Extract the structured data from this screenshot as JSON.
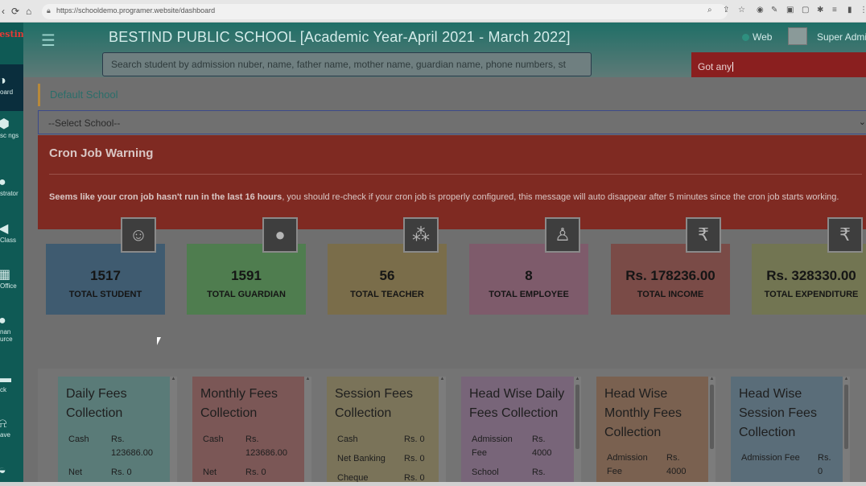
{
  "browser": {
    "url": "https://schooldemo.programer.website/dashboard",
    "nav_back": "◀",
    "nav_forward": "⟳",
    "home": "⌂"
  },
  "sidebar": {
    "logo": "Bestind",
    "items": [
      {
        "label": "oard",
        "icon": "dashboard-icon",
        "active": true
      },
      {
        "label": "sc ngs",
        "icon": "settings-icon"
      },
      {
        "label": "strator",
        "icon": "administrator-icon"
      },
      {
        "label": "Class",
        "icon": "class-icon"
      },
      {
        "label": "Office",
        "icon": "office-icon"
      },
      {
        "label": "nan urce",
        "icon": "human-resource-icon"
      },
      {
        "label": "ck",
        "icon": "book-icon"
      },
      {
        "label": "ave",
        "icon": "leave-icon"
      }
    ]
  },
  "header": {
    "title": "BESTIND PUBLIC SCHOOL [Academic Year-April 2021 - March 2022]",
    "web_label": "Web",
    "user_label": "Super Admin",
    "search_placeholder": "Search student by admission nuber, name, father name, mother name, guardian name, phone numbers, st",
    "chat_input": "Got any"
  },
  "main": {
    "default_school": "Default School",
    "select_school": "--Select School--",
    "cron": {
      "title": "Cron Job Warning",
      "bold_text": "Seems like your cron job hasn't run in the last 16 hours",
      "text": ", you should re-check if your cron job is properly configured, this message will auto disappear after 5 minutes since the cron job starts working."
    },
    "stats": [
      {
        "value": "1517",
        "label": "TOTAL STUDENT",
        "icon": "student-icon",
        "color": "#3f5b70"
      },
      {
        "value": "1591",
        "label": "TOTAL GUARDIAN",
        "icon": "guardian-icon",
        "color": "#4f7d4f"
      },
      {
        "value": "56",
        "label": "TOTAL TEACHER",
        "icon": "teacher-icon",
        "color": "#7a6d4a"
      },
      {
        "value": "8",
        "label": "TOTAL EMPLOYEE",
        "icon": "employee-icon",
        "color": "#7e5b6b"
      },
      {
        "value": "Rs. 178236.00",
        "label": "TOTAL INCOME",
        "icon": "rupee-icon",
        "color": "#7a4b47"
      },
      {
        "value": "Rs. 328330.00",
        "label": "TOTAL EXPENDITURE",
        "icon": "rupee-icon",
        "color": "#727552"
      }
    ],
    "panels": [
      {
        "title": "Daily Fees Collection",
        "color": "#5a7b78",
        "rows": [
          {
            "k": "Cash",
            "v": "Rs. 123686.00"
          },
          {
            "k": "Net",
            "v": "Rs. 0"
          }
        ]
      },
      {
        "title": "Monthly Fees Collection",
        "color": "#7b5756",
        "rows": [
          {
            "k": "Cash",
            "v": "Rs. 123686.00"
          },
          {
            "k": "Net",
            "v": "Rs. 0"
          }
        ]
      },
      {
        "title": "Session Fees Collection",
        "color": "#7a7359",
        "rows": [
          {
            "k": "Cash",
            "v": "Rs. 0"
          },
          {
            "k": "Net Banking",
            "v": "Rs. 0"
          },
          {
            "k": "Cheque",
            "v": "Rs. 0"
          }
        ]
      },
      {
        "title": "Head Wise Daily Fees Collection",
        "color": "#786579",
        "rows": [
          {
            "k": "Admission Fee",
            "v": "Rs. 4000"
          },
          {
            "k": "School",
            "v": "Rs."
          }
        ]
      },
      {
        "title": "Head Wise Monthly Fees Collection",
        "color": "#7a6150",
        "rows": [
          {
            "k": "Admission Fee",
            "v": "Rs. 4000"
          }
        ]
      },
      {
        "title": "Head Wise Session Fees Collection",
        "color": "#5a6d79",
        "rows": [
          {
            "k": "Admission Fee",
            "v": "Rs. 0"
          }
        ]
      }
    ]
  }
}
